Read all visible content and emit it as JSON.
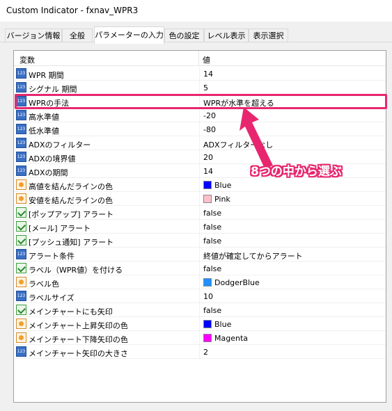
{
  "window": {
    "title": "Custom Indicator - fxnav_WPR3"
  },
  "tabs": [
    {
      "label": "バージョン情報"
    },
    {
      "label": "全般"
    },
    {
      "label": "パラメーターの入力"
    },
    {
      "label": "色の設定"
    },
    {
      "label": "レベル表示"
    },
    {
      "label": "表示選択"
    }
  ],
  "grid": {
    "header_name": "変数",
    "header_value": "値",
    "rows": [
      {
        "name": "WPR 期間",
        "value": "14",
        "icon": "number-icon"
      },
      {
        "name": "シグナル 期間",
        "value": "5",
        "icon": "number-icon"
      },
      {
        "name": "WPRの手法",
        "value": "WPRが水準を超える",
        "icon": "number-icon"
      },
      {
        "name": "高水準値",
        "value": "-20",
        "icon": "number-icon"
      },
      {
        "name": "低水準値",
        "value": "-80",
        "icon": "number-icon"
      },
      {
        "name": "ADXのフィルター",
        "value": "ADXフィルターなし",
        "icon": "number-icon"
      },
      {
        "name": "ADXの境界値",
        "value": "20",
        "icon": "number-icon"
      },
      {
        "name": "ADXの期間",
        "value": "14",
        "icon": "number-icon"
      },
      {
        "name": "高値を結んだラインの色",
        "value": "Blue",
        "icon": "color-icon",
        "swatch": "#0000ff"
      },
      {
        "name": "安値を結んだラインの色",
        "value": "Pink",
        "icon": "color-icon",
        "swatch": "#ffc0cb"
      },
      {
        "name": "[ポップアップ] アラート",
        "value": "false",
        "icon": "bool-icon"
      },
      {
        "name": "[メール] アラート",
        "value": "false",
        "icon": "bool-icon"
      },
      {
        "name": "[プッシュ通知] アラート",
        "value": "false",
        "icon": "bool-icon"
      },
      {
        "name": "アラート条件",
        "value": "終値が確定してからアラート",
        "icon": "number-icon"
      },
      {
        "name": "ラベル（WPR値）を付ける",
        "value": "false",
        "icon": "bool-icon"
      },
      {
        "name": "ラベル色",
        "value": "DodgerBlue",
        "icon": "color-icon",
        "swatch": "#1e90ff"
      },
      {
        "name": "ラベルサイズ",
        "value": "10",
        "icon": "number-icon"
      },
      {
        "name": "メインチャートにも矢印",
        "value": "false",
        "icon": "bool-icon"
      },
      {
        "name": "メインチャート上昇矢印の色",
        "value": "Blue",
        "icon": "color-icon",
        "swatch": "#0000ff"
      },
      {
        "name": "メインチャート下降矢印の色",
        "value": "Magenta",
        "icon": "color-icon",
        "swatch": "#ff00ff"
      },
      {
        "name": "メインチャート矢印の大きさ",
        "value": "2",
        "icon": "number-icon"
      }
    ]
  },
  "annotation": {
    "callout_text": "8つの中から選ぶ",
    "accent_color": "#e8266f"
  }
}
